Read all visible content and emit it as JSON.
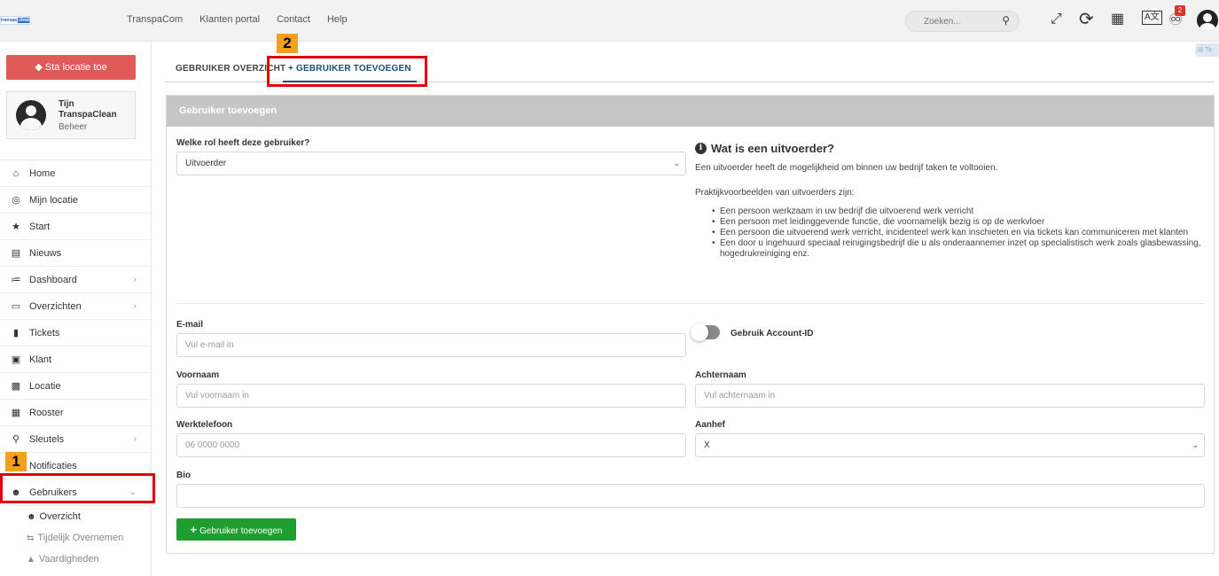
{
  "topbar": {
    "logo": {
      "part1": "transpa",
      "part2": "clean"
    },
    "nav": [
      "TranspaCom",
      "Klanten portal",
      "Contact",
      "Help"
    ],
    "search_placeholder": "Zoeken...",
    "notification_count": "2",
    "icons": [
      "search-icon",
      "compress-icon",
      "refresh-icon",
      "qr-code-icon",
      "translate-icon",
      "bell-icon",
      "user-avatar-icon"
    ]
  },
  "sidebar": {
    "location_button": "Sta locatie toe",
    "user": {
      "name": "Tijn",
      "company": "TranspaClean",
      "role": "Beheer"
    },
    "menu": [
      {
        "label": "Home",
        "icon": "home-icon"
      },
      {
        "label": "Mijn locatie",
        "icon": "globe-icon"
      },
      {
        "label": "Start",
        "icon": "star-icon"
      },
      {
        "label": "Nieuws",
        "icon": "newspaper-icon"
      },
      {
        "label": "Dashboard",
        "icon": "chart-icon"
      },
      {
        "label": "Overzichten",
        "icon": "file-icon"
      },
      {
        "label": "Tickets",
        "icon": "comment-icon"
      },
      {
        "label": "Klant",
        "icon": "building-icon"
      },
      {
        "label": "Locatie",
        "icon": "office-icon"
      },
      {
        "label": "Rooster",
        "icon": "calendar-icon"
      },
      {
        "label": "Sleutels",
        "icon": "key-icon"
      },
      {
        "label": "Notificaties",
        "icon": "bell-icon"
      },
      {
        "label": "Gebruikers",
        "icon": "users-icon"
      }
    ],
    "submenu": [
      {
        "label": "Overzicht",
        "icon": "users-cog-icon"
      },
      {
        "label": "Tijdelijk Overnemen",
        "icon": "exchange-icon"
      },
      {
        "label": "Vaardigheden",
        "icon": "graduation-cap-icon"
      }
    ]
  },
  "annotations": {
    "one": "1",
    "two": "2"
  },
  "tabs": {
    "overview": "GEBRUIKER OVERZICHT",
    "add": "+ GEBRUIKER TOEVOEGEN"
  },
  "form": {
    "panel_title": "Gebruiker toevoegen",
    "role_label": "Welke rol heeft deze gebruiker?",
    "role_value": "Uitvoerder",
    "email_label": "E-mail",
    "email_placeholder": "Vul e-mail in",
    "account_id_label": "Gebruik Account-ID",
    "firstname_label": "Voornaam",
    "firstname_placeholder": "Vul voornaam in",
    "lastname_label": "Achternaam",
    "lastname_placeholder": "Vul achternaam in",
    "phone_label": "Werktelefoon",
    "phone_placeholder": "06 0000 0000",
    "salutation_label": "Aanhef",
    "salutation_value": "X",
    "bio_label": "Bio",
    "submit_label": "Gebruiker toevoegen"
  },
  "info": {
    "title": "Wat is een uitvoerder?",
    "intro": "Een uitvoerder heeft de mogelijkheid om binnen uw bedrijf taken te voltooien.",
    "examples_heading": "Praktijkvoorbeelden van uitvoerders zijn:",
    "examples": [
      "Een persoon werkzaam in uw bedrijf die uitvoerend werk verricht",
      "Een persoon met leidinggevende functie, die voornamelijk bezig is op de werkvloer",
      "Een persoon die uitvoerend werk verricht, incidenteel werk kan inschieten en via tickets kan communiceren met klanten",
      "Een door u ingehuurd speciaal reinigingsbedrijf die u als onderaannemer inzet op specialistisch werk zoals glasbewassing, hogedrukreiniging enz."
    ]
  }
}
